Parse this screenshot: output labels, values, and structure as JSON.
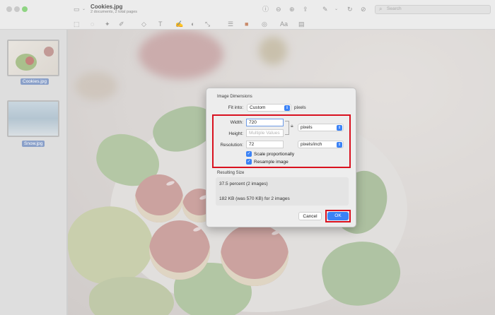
{
  "window": {
    "title": "Cookies.jpg",
    "subtitle": "2 documents, 2 total pages"
  },
  "sidebar": {
    "items": [
      {
        "label": "Cookies.jpg",
        "selected": true
      },
      {
        "label": "Snow.jpg",
        "selected": true
      }
    ]
  },
  "toolbar": {
    "icons": [
      "sidebar-toggle-icon",
      "info-icon",
      "zoom-out-icon",
      "zoom-in-icon",
      "share-icon",
      "markup-icon",
      "rotate-icon",
      "pen-icon",
      "lasso-icon",
      "shapes-icon",
      "text-icon",
      "sign-icon",
      "adjust-color-icon",
      "adjust-size-icon",
      "border-color-icon",
      "fill-color-icon",
      "font-icon",
      "description-icon"
    ]
  },
  "search": {
    "placeholder": "Search"
  },
  "dialog": {
    "section_title": "Image Dimensions",
    "fit_into_label": "Fit into:",
    "fit_into_value": "Custom",
    "fit_into_unit": "pixels",
    "width_label": "Width:",
    "width_value": "720",
    "height_label": "Height:",
    "height_placeholder": "Multiple Values",
    "size_unit": "pixels",
    "resolution_label": "Resolution:",
    "resolution_value": "72",
    "resolution_unit": "pixels/inch",
    "scale_label": "Scale proportionally",
    "scale_checked": true,
    "resample_label": "Resample image",
    "resample_checked": true,
    "result_title": "Resulting Size",
    "result_percent": "37.5 percent (2 images)",
    "result_size": "182 KB (was 570 KB) for 2 images",
    "cancel_label": "Cancel",
    "ok_label": "OK"
  },
  "colors": {
    "accent": "#3b82f6",
    "highlight": "#d9111f",
    "traffic_green": "#8fd483"
  }
}
